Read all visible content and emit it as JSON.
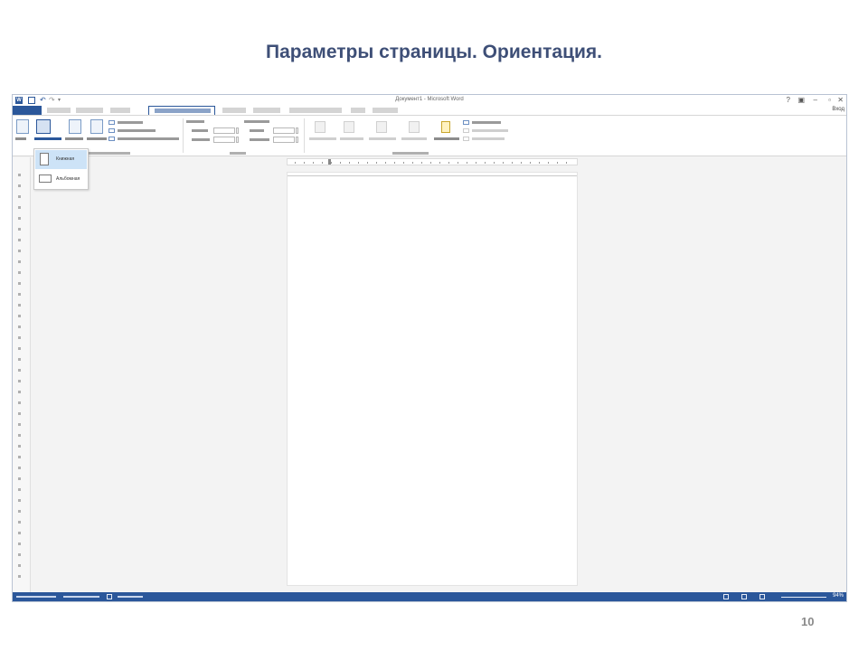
{
  "slide": {
    "title": "Параметры страницы. Ориентация.",
    "page_number": "10"
  },
  "word": {
    "title_bar": "Документ1 - Microsoft Word",
    "orientation_menu": {
      "items": [
        "Книжная",
        "Альбомная"
      ]
    },
    "zoom": "94%"
  },
  "colors": {
    "title": "#3e4f77",
    "accent": "#2b579a"
  }
}
